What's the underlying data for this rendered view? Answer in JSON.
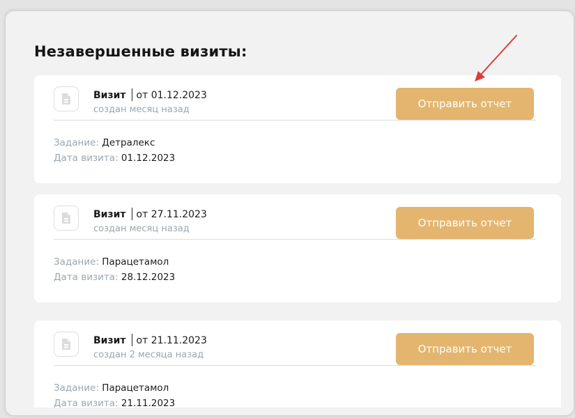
{
  "section": {
    "title": "Незавершенные визиты:"
  },
  "visits": [
    {
      "type_label": "Визит",
      "date_label": "от 01.12.2023",
      "created": "создан месяц назад",
      "send_label": "Отправить отчет",
      "task_key": "Задание:",
      "task_value": "Детралекс",
      "visit_date_key": "Дата визита:",
      "visit_date_value": "01.12.2023"
    },
    {
      "type_label": "Визит",
      "date_label": "от 27.11.2023",
      "created": "создан месяц назад",
      "send_label": "Отправить отчет",
      "task_key": "Задание:",
      "task_value": "Парацетамол",
      "visit_date_key": "Дата визита:",
      "visit_date_value": "28.12.2023"
    },
    {
      "type_label": "Визит",
      "date_label": "от 21.11.2023",
      "created": "создан 2 месяца назад",
      "send_label": "Отправить отчет",
      "task_key": "Задание:",
      "task_value": "Парацетамол",
      "visit_date_key": "Дата визита:",
      "visit_date_value": "21.11.2023"
    }
  ],
  "colors": {
    "accent_button": "#e3b56e",
    "muted_text": "#9aa6b1",
    "annotation_arrow": "#e53935",
    "panel_background": "#f2f2f2",
    "card_background": "#ffffff"
  },
  "icons": {
    "visit_icon": "document-icon",
    "annotation": "red-arrow-icon"
  }
}
